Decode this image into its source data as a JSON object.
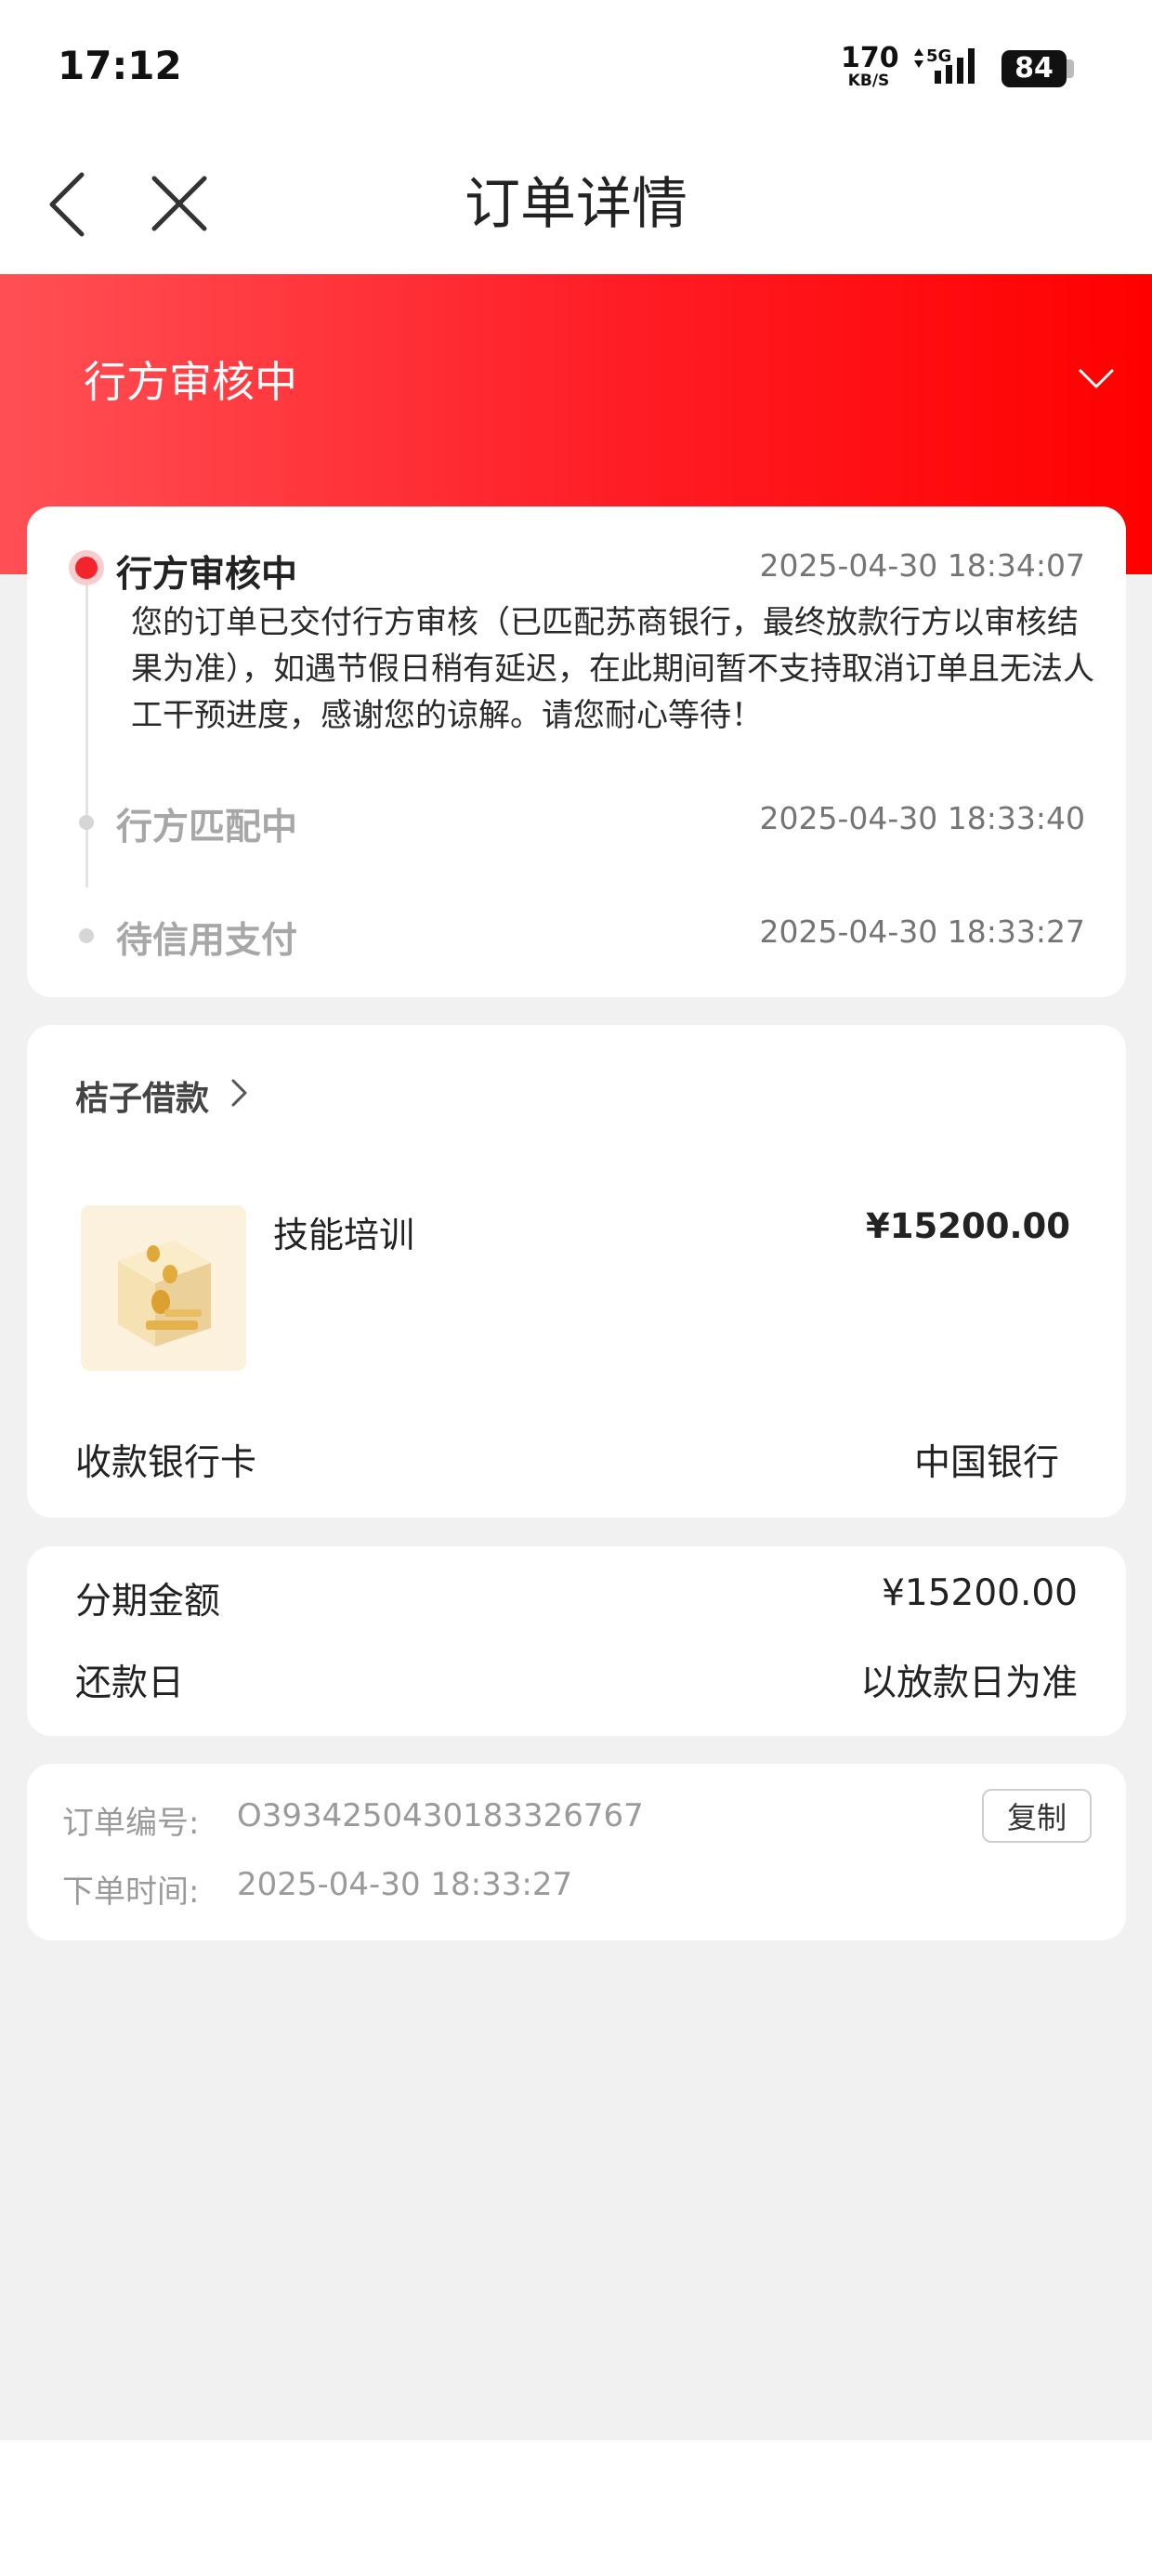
{
  "status_bar": {
    "time": "17:12",
    "net_speed": "170",
    "net_unit": "KB/S",
    "network": "5G",
    "battery": "84"
  },
  "nav": {
    "title": "订单详情",
    "back_icon": "back-icon",
    "close_icon": "close-icon"
  },
  "hero": {
    "title": "行方审核中",
    "chevron_icon": "chevron-down-icon",
    "gradient": [
      "#ff5055",
      "#ff0000"
    ]
  },
  "timeline": [
    {
      "title": "行方审核中",
      "time": "2025-04-30 18:34:07",
      "description": "您的订单已交付行方审核（已匹配苏商银行，最终放款行方以审核结果为准），如遇节假日稍有延迟，在此期间暂不支持取消订单且无法人工干预进度，感谢您的谅解。请您耐心等待！",
      "active": true
    },
    {
      "title": "行方匹配中",
      "time": "2025-04-30 18:33:40",
      "active": false
    },
    {
      "title": "待信用支付",
      "time": "2025-04-30 18:33:27",
      "active": false
    }
  ],
  "order": {
    "merchant": "桔子借款",
    "product_name": "技能培训",
    "product_price": "¥15200.00",
    "bank_card_label": "收款银行卡",
    "bank_card_value": "中国银行"
  },
  "installment": {
    "amount_label": "分期金额",
    "amount_value": "¥15200.00",
    "repay_label": "还款日",
    "repay_value": "以放款日为准"
  },
  "meta": {
    "order_no_label": "订单编号:",
    "order_no_value": "O3934250430183326767",
    "copy_label": "复制",
    "order_time_label": "下单时间:",
    "order_time_value": "2025-04-30 18:33:27"
  },
  "colors": {
    "accent": "#f2252c",
    "background": "#f1f1f1"
  }
}
